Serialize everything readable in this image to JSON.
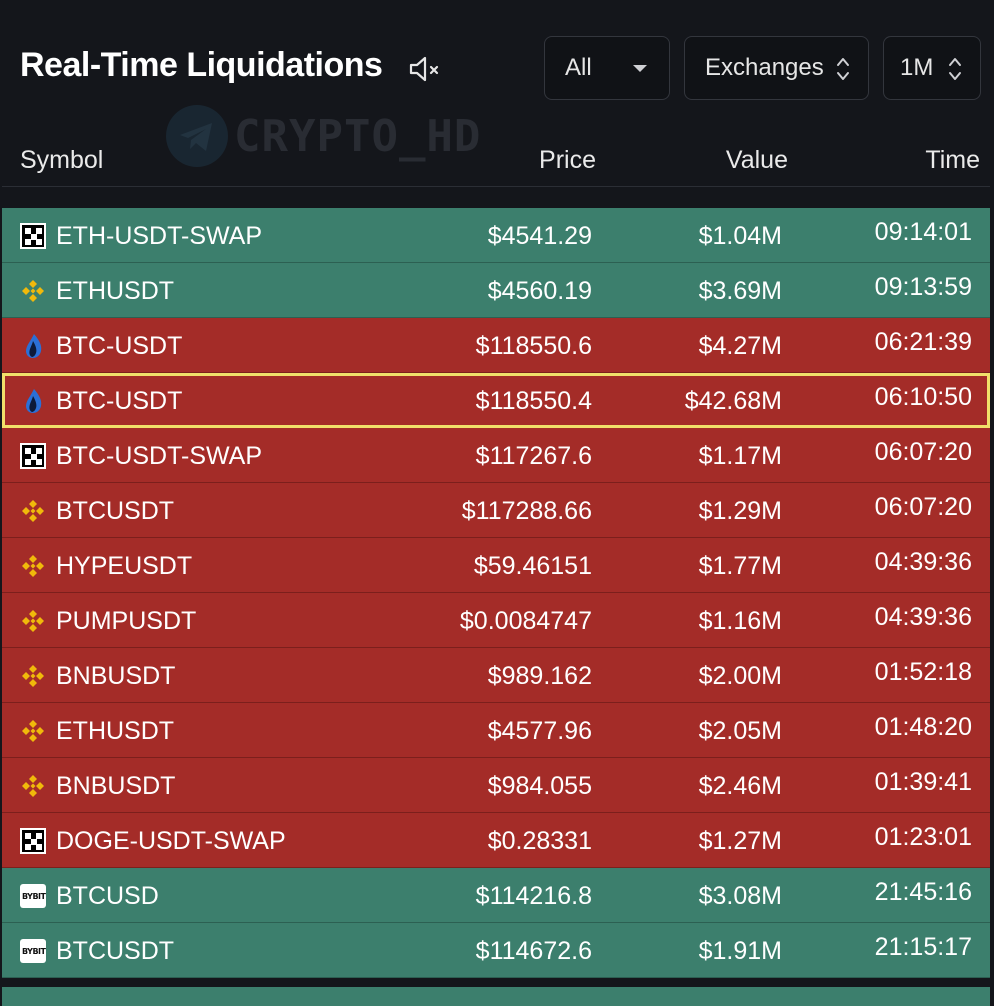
{
  "header": {
    "title": "Real-Time Liquidations",
    "filter_all": "All",
    "filter_exchanges": "Exchanges",
    "filter_timeframe": "1M"
  },
  "watermark": {
    "text": "CRYPTO_HD"
  },
  "columns": {
    "symbol": "Symbol",
    "price": "Price",
    "value": "Value",
    "time": "Time"
  },
  "colors": {
    "long": "#3c7f6d",
    "short": "#a42c28",
    "highlight": "#f1e06a",
    "background": "#14161b"
  },
  "rows": [
    {
      "icon": "okx-icon",
      "symbol": "ETH-USDT-SWAP",
      "price": "$4541.29",
      "value": "$1.04M",
      "time": "09:14:01",
      "side": "long"
    },
    {
      "icon": "binance-icon",
      "symbol": "ETHUSDT",
      "price": "$4560.19",
      "value": "$3.69M",
      "time": "09:13:59",
      "side": "long"
    },
    {
      "icon": "huobi-icon",
      "symbol": "BTC-USDT",
      "price": "$118550.6",
      "value": "$4.27M",
      "time": "06:21:39",
      "side": "short"
    },
    {
      "icon": "huobi-icon",
      "symbol": "BTC-USDT",
      "price": "$118550.4",
      "value": "$42.68M",
      "time": "06:10:50",
      "side": "short",
      "highlighted": true
    },
    {
      "icon": "okx-icon",
      "symbol": "BTC-USDT-SWAP",
      "price": "$117267.6",
      "value": "$1.17M",
      "time": "06:07:20",
      "side": "short"
    },
    {
      "icon": "binance-icon",
      "symbol": "BTCUSDT",
      "price": "$117288.66",
      "value": "$1.29M",
      "time": "06:07:20",
      "side": "short"
    },
    {
      "icon": "binance-icon",
      "symbol": "HYPEUSDT",
      "price": "$59.46151",
      "value": "$1.77M",
      "time": "04:39:36",
      "side": "short"
    },
    {
      "icon": "binance-icon",
      "symbol": "PUMPUSDT",
      "price": "$0.0084747",
      "value": "$1.16M",
      "time": "04:39:36",
      "side": "short"
    },
    {
      "icon": "binance-icon",
      "symbol": "BNBUSDT",
      "price": "$989.162",
      "value": "$2.00M",
      "time": "01:52:18",
      "side": "short"
    },
    {
      "icon": "binance-icon",
      "symbol": "ETHUSDT",
      "price": "$4577.96",
      "value": "$2.05M",
      "time": "01:48:20",
      "side": "short"
    },
    {
      "icon": "binance-icon",
      "symbol": "BNBUSDT",
      "price": "$984.055",
      "value": "$2.46M",
      "time": "01:39:41",
      "side": "short"
    },
    {
      "icon": "okx-icon",
      "symbol": "DOGE-USDT-SWAP",
      "price": "$0.28331",
      "value": "$1.27M",
      "time": "01:23:01",
      "side": "short"
    },
    {
      "icon": "bybit-icon",
      "symbol": "BTCUSD",
      "price": "$114216.8",
      "value": "$3.08M",
      "time": "21:45:16",
      "side": "long"
    },
    {
      "icon": "bybit-icon",
      "symbol": "BTCUSDT",
      "price": "$114672.6",
      "value": "$1.91M",
      "time": "21:15:17",
      "side": "long"
    }
  ],
  "icons": {
    "bybit_text": "BYBIT"
  }
}
